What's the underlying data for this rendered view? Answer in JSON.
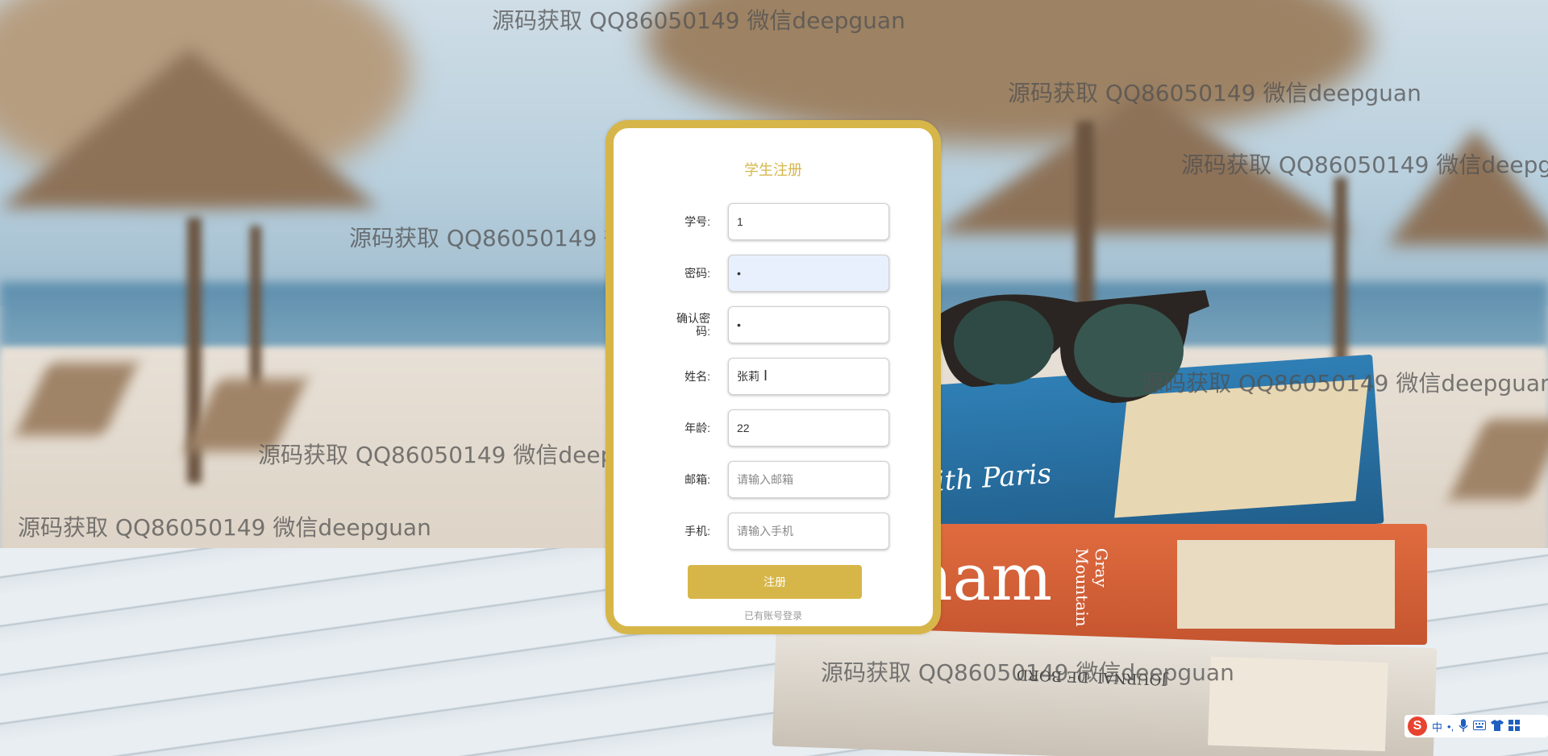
{
  "page": {
    "title": "学生注册"
  },
  "watermark": {
    "text": "源码获取 QQ86050149 微信deepguan"
  },
  "form": {
    "student_id": {
      "label": "学号:",
      "value": "1",
      "placeholder": ""
    },
    "password": {
      "label": "密码:",
      "value": "•",
      "placeholder": ""
    },
    "confirm_password": {
      "label": "确认密码:",
      "value": "•",
      "placeholder": ""
    },
    "name": {
      "label": "姓名:",
      "value": "张莉",
      "placeholder": ""
    },
    "age": {
      "label": "年龄:",
      "value": "22",
      "placeholder": ""
    },
    "email": {
      "label": "邮箱:",
      "value": "",
      "placeholder": "请输入邮箱"
    },
    "phone": {
      "label": "手机:",
      "value": "",
      "placeholder": "请输入手机"
    },
    "register_button": "注册",
    "login_link": "已有账号登录"
  },
  "background": {
    "book_titles": [
      "with Paris",
      "ham",
      "Gray Mountain",
      "JOURNAL DE BORD"
    ]
  },
  "ime_toolbar": {
    "logo": "S",
    "items": [
      "中",
      "•,",
      "mic-icon",
      "keyboard-icon",
      "shirt-icon",
      "grid-icon"
    ]
  },
  "colors": {
    "accent": "#d7b649",
    "input_focus": "#e8f0fe"
  }
}
